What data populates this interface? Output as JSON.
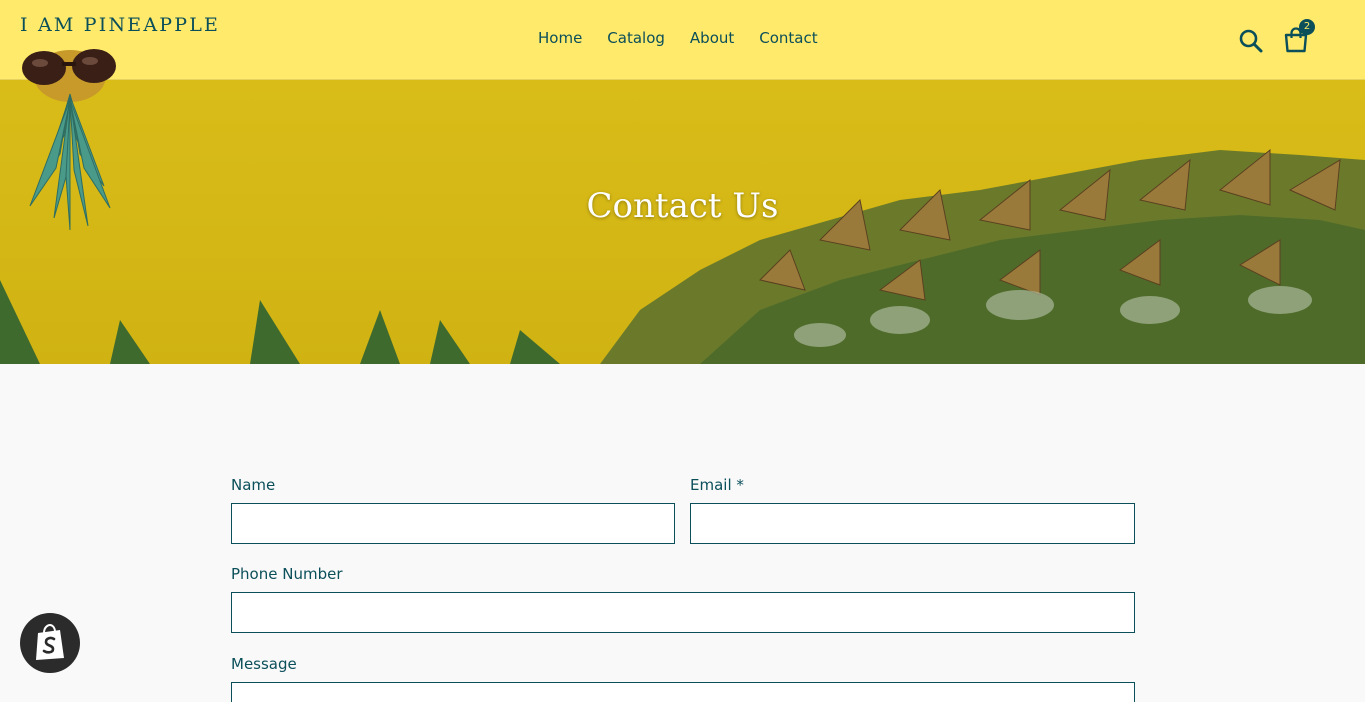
{
  "header": {
    "logo_text": "I AM PINEAPPLE",
    "nav": [
      "Home",
      "Catalog",
      "About",
      "Contact"
    ],
    "cart_count": "2"
  },
  "hero": {
    "title": "Contact Us"
  },
  "form": {
    "name_label": "Name",
    "email_label": "Email *",
    "phone_label": "Phone Number",
    "message_label": "Message",
    "name_value": "",
    "email_value": "",
    "phone_value": ""
  },
  "colors": {
    "header_bg": "#ffea6b",
    "hero_bg": "#d4b717",
    "text": "#0b4f5a",
    "page_bg": "#f9f9f9"
  },
  "icons": [
    "search-icon",
    "cart-icon",
    "shopify-icon"
  ]
}
